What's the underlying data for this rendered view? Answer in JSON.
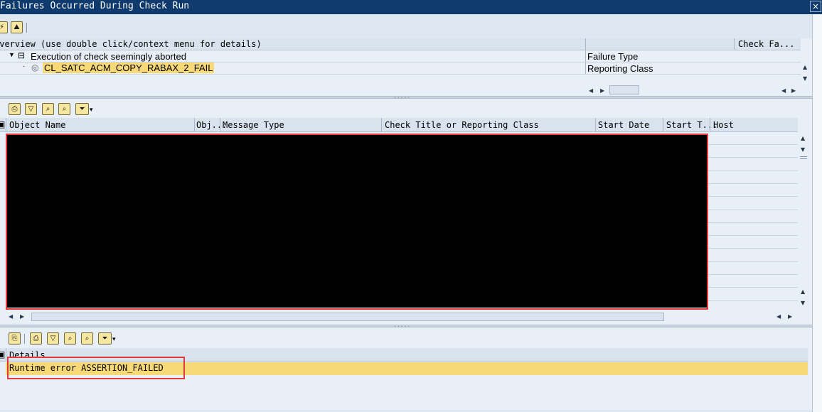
{
  "window": {
    "title": "Failures Occurred During Check Run",
    "close": "×"
  },
  "top_toolbar": {
    "btn1": "⚡",
    "btn2": "⛰"
  },
  "overview": {
    "header": "Overview (use double click/context menu for details)",
    "right_header": "Check Fa...",
    "tree": [
      {
        "label": "Execution of check seemingly aborted",
        "right": "Failure Type"
      },
      {
        "label": "CL_SATC_ACM_COPY_RABAX_2_FAIL",
        "right": "Reporting Class"
      }
    ]
  },
  "mid_toolbar": {
    "print": "⎙",
    "filter": "▽",
    "find": "⌕",
    "find_next": "⌕",
    "more": "⏷"
  },
  "table": {
    "columns": [
      "Object Name",
      "Obj...",
      "Message Type",
      "Check Title or Reporting Class",
      "Start Date",
      "Start T...",
      "Host"
    ],
    "row_count": 13
  },
  "details_toolbar": {
    "details": "⎘",
    "print": "⎙",
    "filter": "▽",
    "find": "⌕",
    "find_next": "⌕",
    "more": "⏷"
  },
  "details": {
    "header": "Details",
    "row": "Runtime error ASSERTION_FAILED"
  },
  "colors": {
    "titlebar": "#0f3a6e",
    "highlight": "#f8d978",
    "red_annotation": "#e03a3a",
    "panel": "#e9eff6"
  }
}
